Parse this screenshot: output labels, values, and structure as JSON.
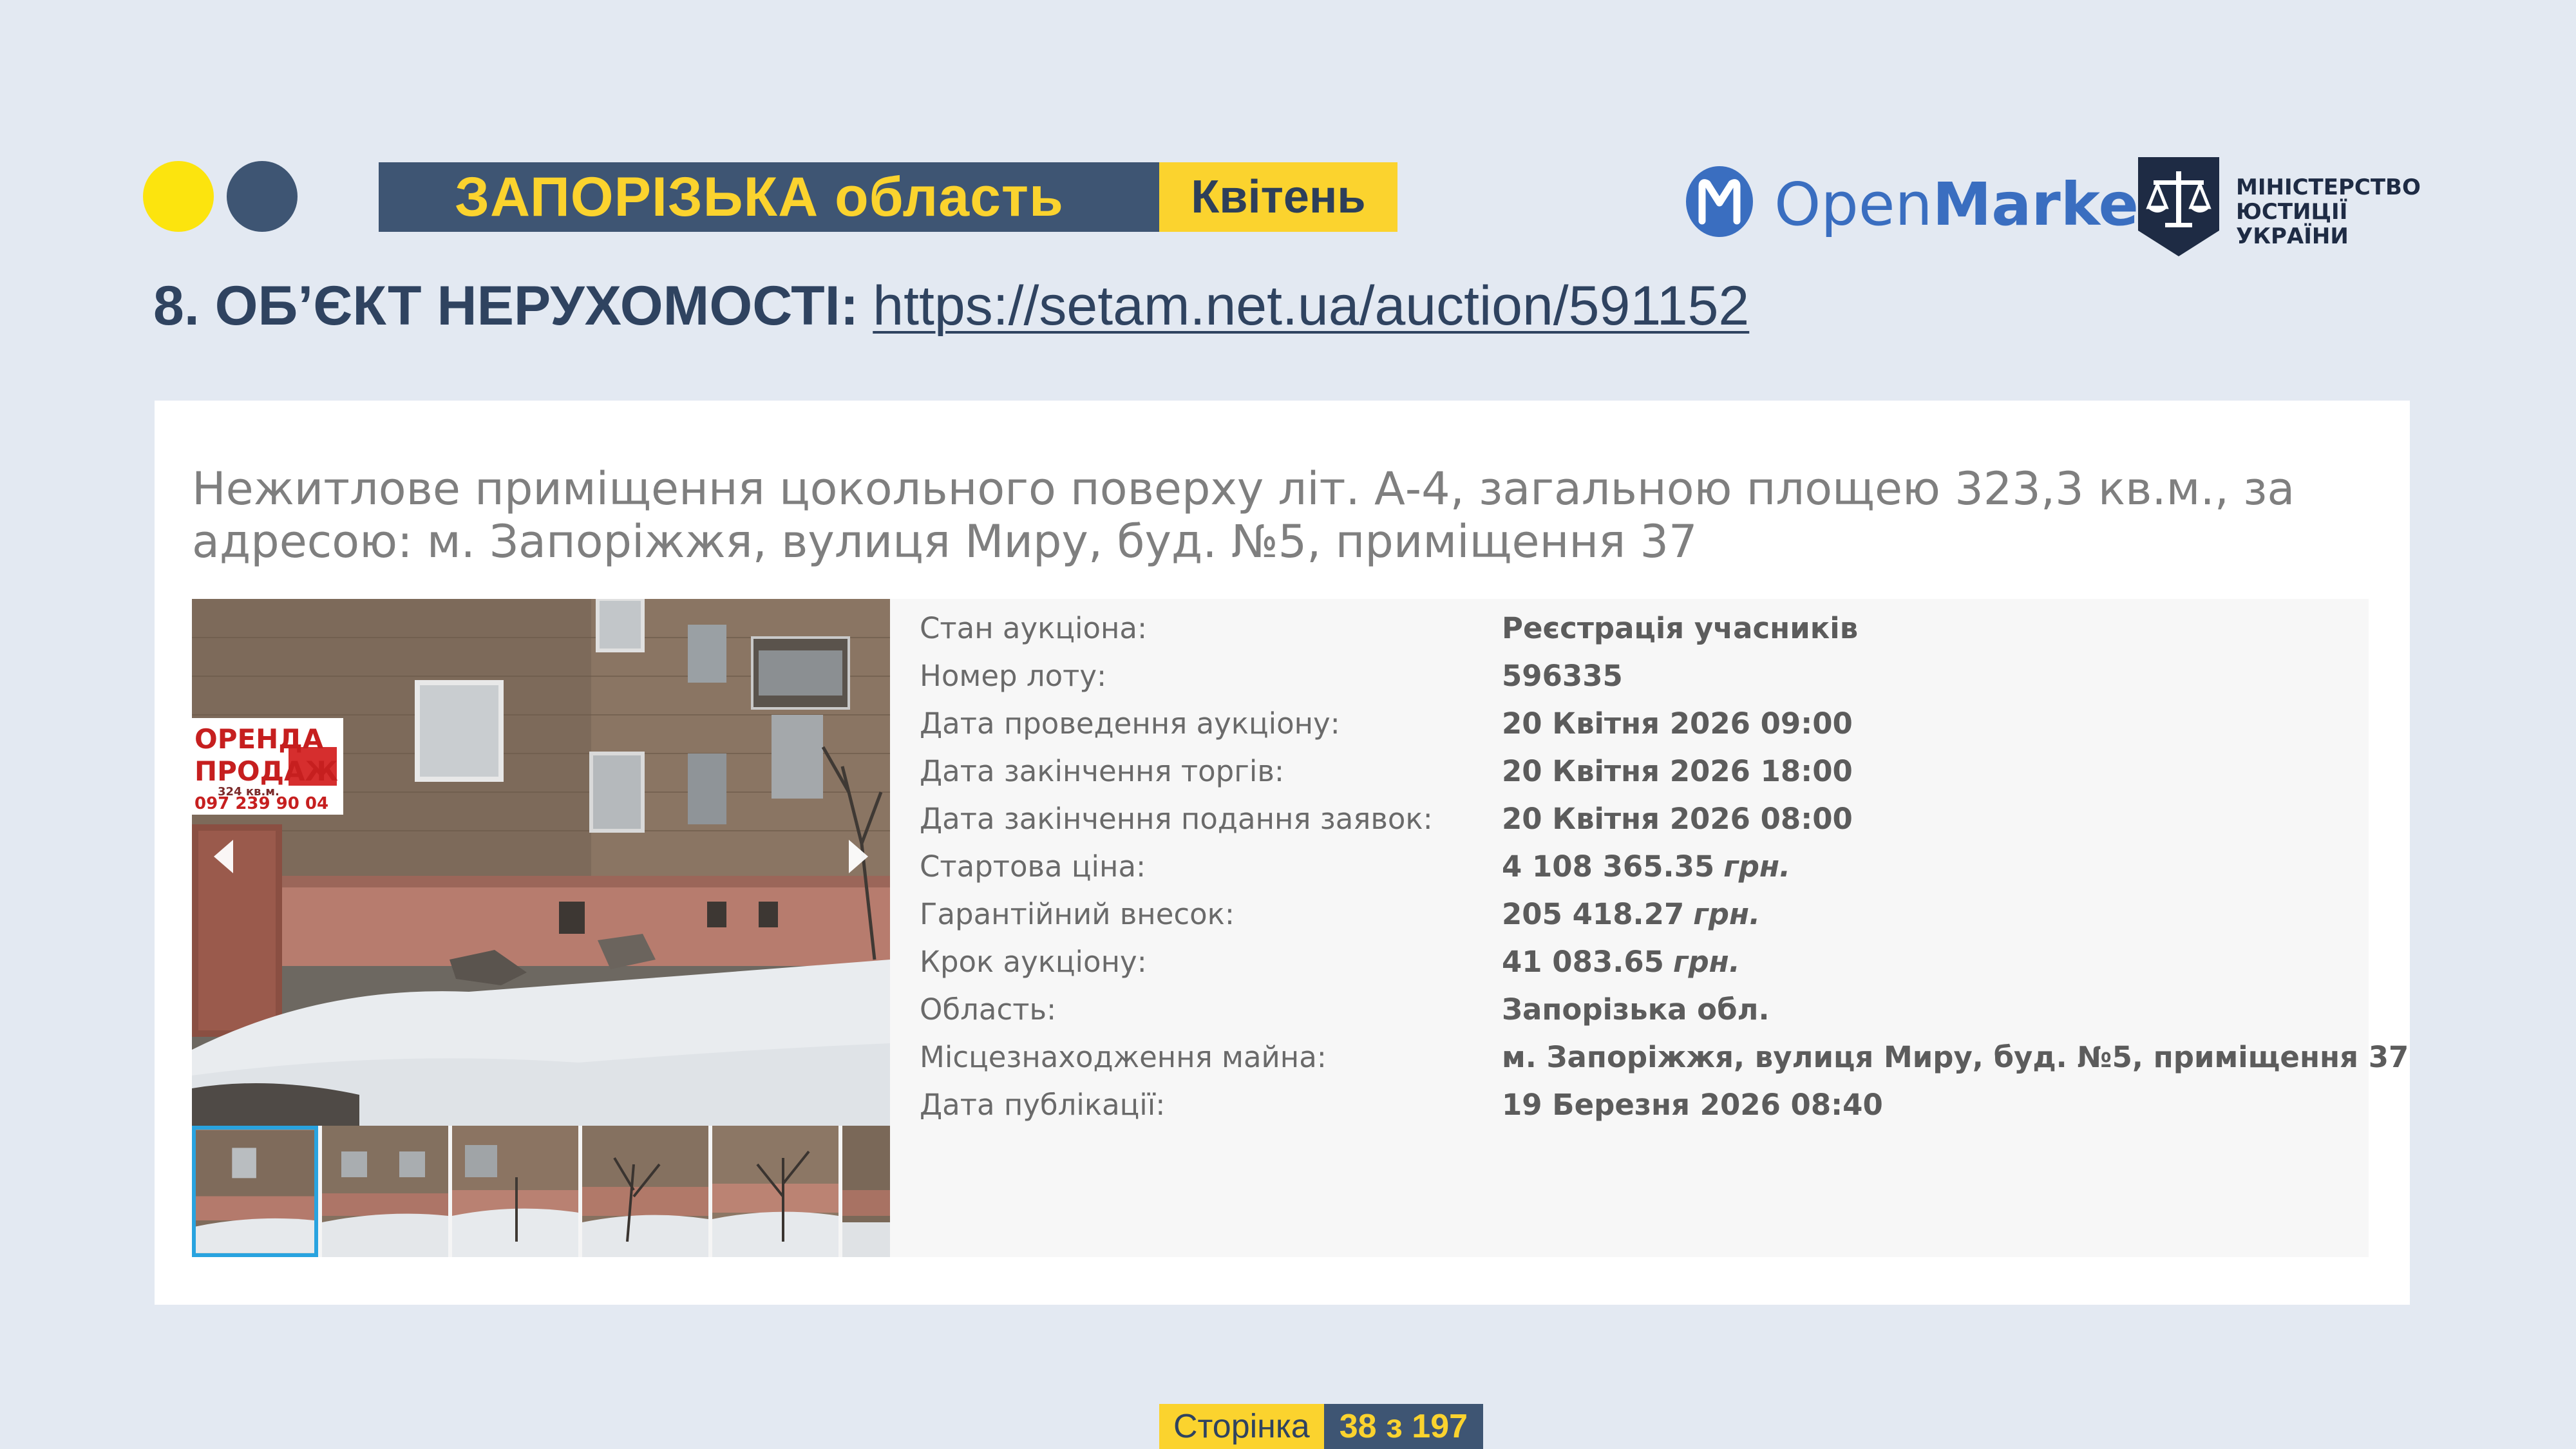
{
  "header": {
    "region": "ЗАПОРІЗЬКА область",
    "month": "Квітень",
    "openmarket_logo": {
      "open": "Open",
      "market": "Market",
      "icon": "openmarket-m-icon"
    },
    "ministry_logo": {
      "line1": "МІНІСТЕРСТВО",
      "line2": "ЮСТИЦІЇ УКРАЇНИ",
      "icon": "scales-shield-icon"
    }
  },
  "object": {
    "heading_prefix": "8. ОБ’ЄКТ НЕРУХОМОСТІ:",
    "link": "https://setam.net.ua/auction/591152"
  },
  "lot": {
    "title": "Нежитлове приміщення цокольного поверху літ. А-4, загальною площею 323,3 кв.м., за адресою: м. Запоріжжя, вулиця Миру, буд. №5, приміщення 37",
    "photo_sign": {
      "line1": "ОРЕНДА",
      "line2": "ПРОДАЖ",
      "area": "324 кв.м.",
      "phone": "097 239 90 04"
    },
    "details": [
      {
        "label": "Стан аукціона:",
        "value": "Реєстрація учасників",
        "currency": ""
      },
      {
        "label": "Номер лоту:",
        "value": "596335",
        "currency": ""
      },
      {
        "label": "Дата проведення аукціону:",
        "value": "20 Квітня 2026 09:00",
        "currency": ""
      },
      {
        "label": "Дата закінчення торгів:",
        "value": "20 Квітня 2026 18:00",
        "currency": ""
      },
      {
        "label": "Дата закінчення подання заявок:",
        "value": "20 Квітня 2026 08:00",
        "currency": ""
      },
      {
        "label": "Стартова ціна:",
        "value": "4 108 365.35",
        "currency": "грн."
      },
      {
        "label": "Гарантійний внесок:",
        "value": "205 418.27",
        "currency": "грн."
      },
      {
        "label": "Крок аукціону:",
        "value": "41 083.65",
        "currency": "грн."
      },
      {
        "label": "Область:",
        "value": "Запорізька обл.",
        "currency": ""
      },
      {
        "label": "Місцезнаходження майна:",
        "value": "м. Запоріжжя, вулиця Миру, буд. №5, приміщення 37",
        "currency": ""
      },
      {
        "label": "Дата публікації:",
        "value": "19 Березня 2026 08:40",
        "currency": ""
      }
    ]
  },
  "footer": {
    "page_word": "Сторінка",
    "page_number": "38 з 197"
  },
  "colors": {
    "background": "#e3e9f2",
    "navy": "#3e5573",
    "yellow": "#fbd32e",
    "bright_yellow": "#fce40e",
    "openmarket_blue": "#3a6ec0",
    "thumb_active_border": "#29a3df"
  }
}
